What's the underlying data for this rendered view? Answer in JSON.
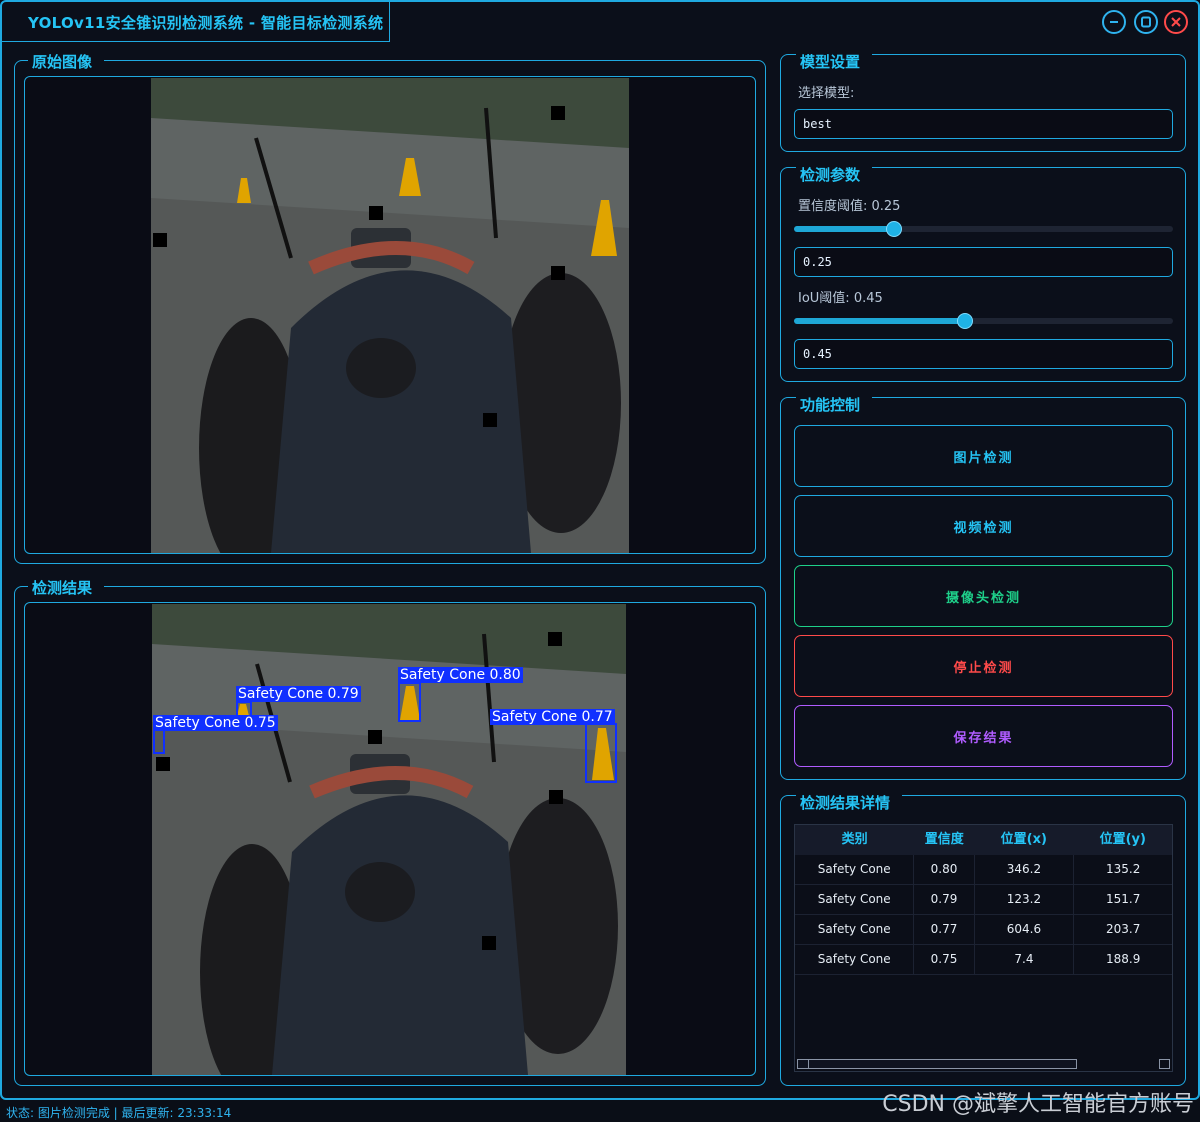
{
  "window": {
    "title": "YOLOv11安全锥识别检测系统 - 智能目标检测系统",
    "buttons": [
      "minimize",
      "maximize",
      "close"
    ]
  },
  "panels": {
    "original": {
      "label": "原始图像"
    },
    "result": {
      "label": "检测结果"
    }
  },
  "detections_overlay": [
    {
      "label": "Safety Cone 0.80"
    },
    {
      "label": "Safety Cone 0.79"
    },
    {
      "label": "Safety Cone 0.77"
    },
    {
      "label": "Safety Cone 0.75"
    }
  ],
  "model": {
    "group_label": "模型设置",
    "select_label": "选择模型:",
    "selected": "best"
  },
  "params": {
    "group_label": "检测参数",
    "conf_label": "置信度阈值: 0.25",
    "conf_value": "0.25",
    "conf_level": 0.25,
    "iou_label": "IoU阈值: 0.45",
    "iou_value": "0.45",
    "iou_level": 0.45
  },
  "controls": {
    "group_label": "功能控制",
    "image_detect": "图片检测",
    "video_detect": "视频检测",
    "camera_detect": "摄像头检测",
    "stop_detect": "停止检测",
    "save_result": "保存结果"
  },
  "results": {
    "group_label": "检测结果详情",
    "columns": [
      "类别",
      "置信度",
      "位置(x)",
      "位置(y)"
    ],
    "rows": [
      [
        "Safety Cone",
        "0.80",
        "346.2",
        "135.2"
      ],
      [
        "Safety Cone",
        "0.79",
        "123.2",
        "151.7"
      ],
      [
        "Safety Cone",
        "0.77",
        "604.6",
        "203.7"
      ],
      [
        "Safety Cone",
        "0.75",
        "7.4",
        "188.9"
      ]
    ]
  },
  "status": "状态: 图片检测完成 | 最后更新: 23:33:14",
  "watermark": "CSDN @斌擎人工智能官方账号",
  "colors": {
    "accent": "#25c4f5",
    "border": "#1fa9e0",
    "stop": "#ff4a4a",
    "camera": "#1ed08a",
    "save": "#b05cff"
  }
}
